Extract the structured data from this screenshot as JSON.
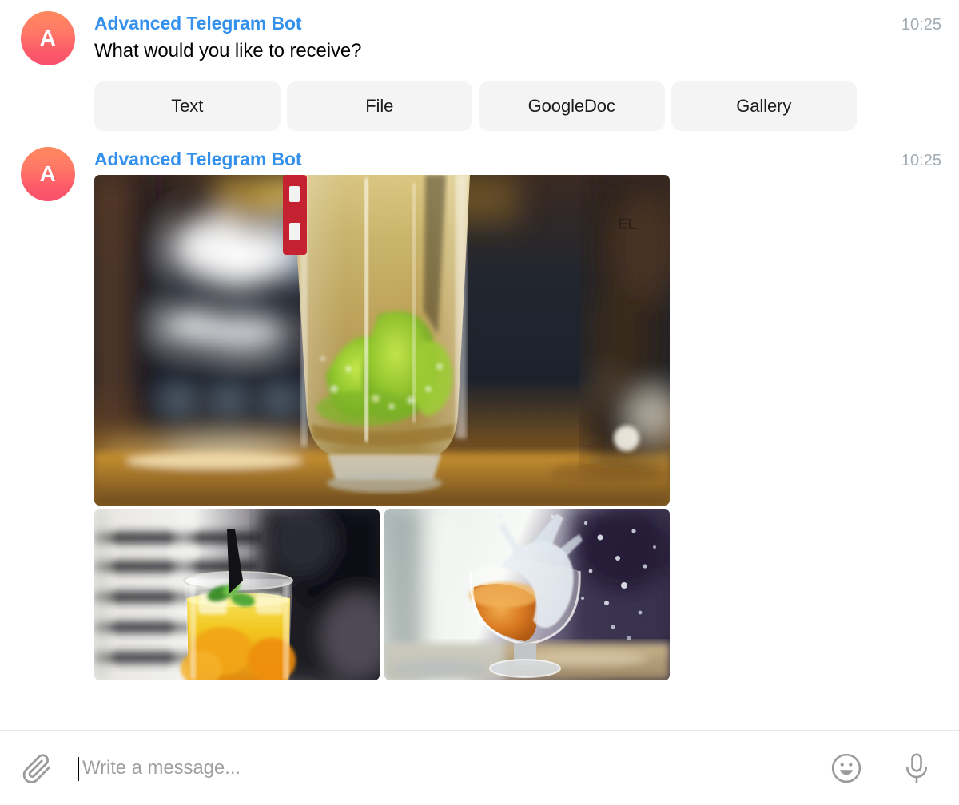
{
  "messages": [
    {
      "avatar_letter": "A",
      "sender": "Advanced Telegram Bot",
      "time": "10:25",
      "text": "What would you like to receive?",
      "buttons": [
        {
          "label": "Text"
        },
        {
          "label": "File"
        },
        {
          "label": "GoogleDoc"
        },
        {
          "label": "Gallery"
        }
      ]
    },
    {
      "avatar_letter": "A",
      "sender": "Advanced Telegram Bot",
      "time": "10:25",
      "album": [
        {
          "alt": "cocktail-glass-with-lime-on-bar-counter"
        },
        {
          "alt": "orange-juice-cocktail-with-black-straw-and-mint"
        },
        {
          "alt": "brandy-glass-water-splash-with-orange-drink"
        }
      ]
    }
  ],
  "composer": {
    "attach_icon": "paperclip-icon",
    "placeholder": "Write a message...",
    "value": "",
    "emoji_icon": "smiley-icon",
    "mic_icon": "microphone-icon"
  },
  "colors": {
    "sender_name": "#3390ec",
    "timestamp": "#a2acb4",
    "button_bg": "#f4f4f5",
    "avatar_gradient_start": "#ff885e",
    "avatar_gradient_end": "#f9506d",
    "separator": "#e7e7e7",
    "placeholder": "#a0a0a0"
  }
}
